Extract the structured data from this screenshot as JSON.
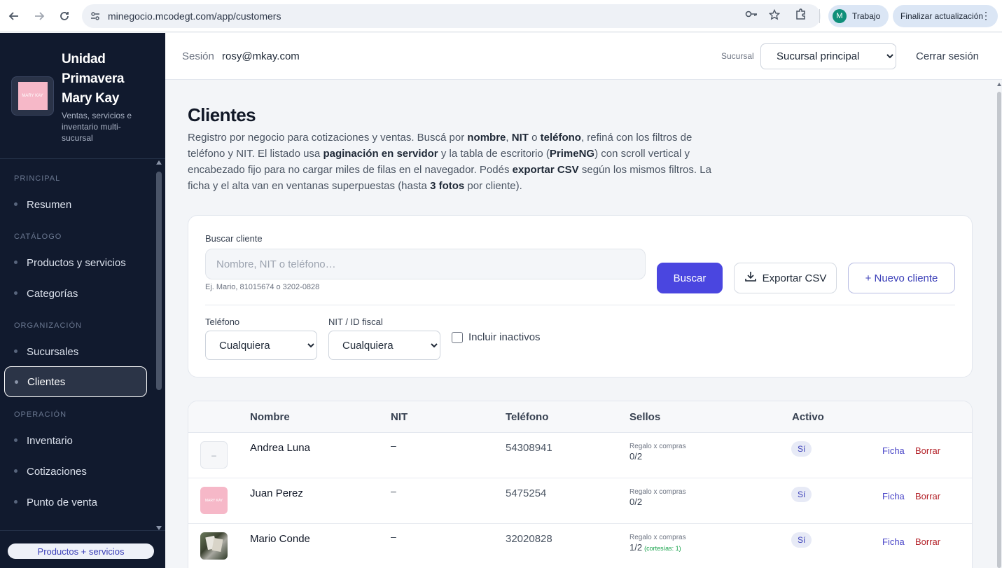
{
  "browser": {
    "url": "minegocio.mcodegt.com/app/customers",
    "profile_initial": "M",
    "profile_name": "Trabajo",
    "update_label": "Finalizar actualización"
  },
  "sidebar": {
    "brand_name": "Unidad Primavera Mary Kay",
    "brand_sub": "Ventas, servicios e inventario multi-sucursal",
    "logo_text": "MARY KAY",
    "sections": [
      {
        "title": "PRINCIPAL",
        "items": [
          "Resumen"
        ]
      },
      {
        "title": "CATÁLOGO",
        "items": [
          "Productos y servicios",
          "Categorías"
        ]
      },
      {
        "title": "ORGANIZACIÓN",
        "items": [
          "Sucursales",
          "Clientes"
        ]
      },
      {
        "title": "OPERACIÓN",
        "items": [
          "Inventario",
          "Cotizaciones",
          "Punto de venta"
        ]
      }
    ],
    "active_item": "Clientes",
    "footer_label": "Productos + servicios"
  },
  "topbar": {
    "session_label": "Sesión",
    "session_user": "rosy@mkay.com",
    "branch_label": "Sucursal",
    "branch_value": "Sucursal principal",
    "logout_label": "Cerrar sesión"
  },
  "page": {
    "title": "Clientes",
    "description_parts": {
      "p1": "Registro por negocio para cotizaciones y ventas. Buscá por ",
      "b1": "nombre",
      "p2": ", ",
      "b2": "NIT",
      "p3": " o ",
      "b3": "teléfono",
      "p4": ", refiná con los filtros de teléfono y NIT. El listado usa ",
      "b4": "paginación en servidor",
      "p5": " y la tabla de escritorio (",
      "b5": "PrimeNG",
      "p6": ") con scroll vertical y encabezado fijo para no cargar miles de filas en el navegador. Podés ",
      "b6": "exportar CSV",
      "p7": " según los mismos filtros. La ficha y el alta van en ventanas superpuestas (hasta ",
      "b7": "3 fotos",
      "p8": " por cliente)."
    }
  },
  "filters": {
    "search_label": "Buscar cliente",
    "search_placeholder": "Nombre, NIT o teléfono…",
    "search_value": "",
    "search_hint": "Ej. Mario, 81015674 o 3202-0828",
    "search_button": "Buscar",
    "export_button": "Exportar CSV",
    "new_button": "+ Nuevo cliente",
    "phone_label": "Teléfono",
    "phone_value": "Cualquiera",
    "nit_label": "NIT / ID fiscal",
    "nit_value": "Cualquiera",
    "include_inactive_label": "Incluir inactivos",
    "include_inactive_checked": false
  },
  "table": {
    "headers": [
      "Nombre",
      "NIT",
      "Teléfono",
      "Sellos",
      "Activo"
    ],
    "rows": [
      {
        "thumb": "empty",
        "thumb_text": "–",
        "name": "Andrea Luna",
        "nit": "–",
        "phone": "54308941",
        "stamp_label": "Regalo x compras",
        "stamps": "0/2",
        "courtesy": "",
        "active": "Sí",
        "view": "Ficha",
        "delete": "Borrar"
      },
      {
        "thumb": "logo",
        "thumb_text": "MARY KAY",
        "name": "Juan Perez",
        "nit": "–",
        "phone": "5475254",
        "stamp_label": "Regalo x compras",
        "stamps": "0/2",
        "courtesy": "",
        "active": "Sí",
        "view": "Ficha",
        "delete": "Borrar"
      },
      {
        "thumb": "photo",
        "thumb_text": "",
        "name": "Mario Conde",
        "nit": "–",
        "phone": "32020828",
        "stamp_label": "Regalo x compras",
        "stamps": "1/2",
        "courtesy": "(cortesías: 1)",
        "active": "Sí",
        "view": "Ficha",
        "delete": "Borrar"
      }
    ]
  },
  "colors": {
    "sidebar_bg": "#111a2e",
    "primary": "#4a46e0",
    "danger": "#b4232a",
    "brand_pink": "#f6b8c8"
  },
  "icons": {
    "back": "arrow-left-icon",
    "forward": "arrow-right-icon",
    "reload": "reload-icon",
    "site_info": "tune-icon",
    "password": "key-icon",
    "bookmark": "star-icon",
    "extensions": "puzzle-icon",
    "menu": "more-vert-icon",
    "export": "download-icon"
  }
}
